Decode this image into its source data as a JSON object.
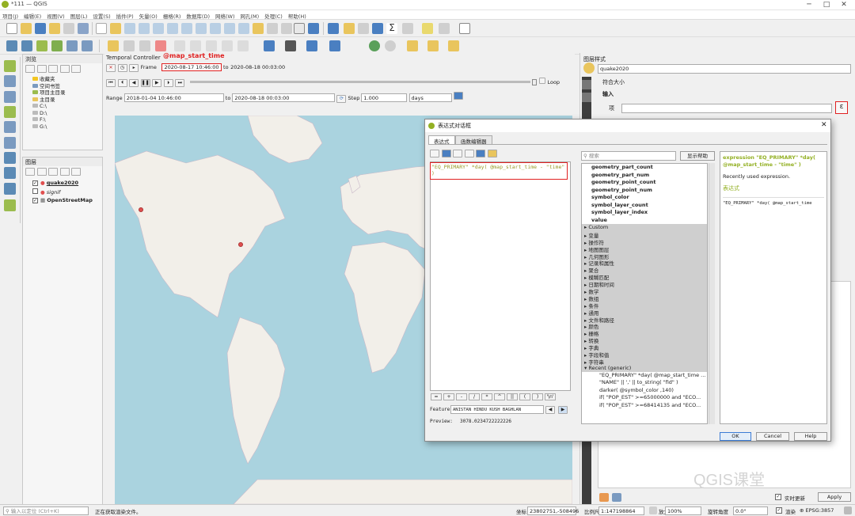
{
  "window": {
    "title": "*111 — QGIS"
  },
  "menu": [
    "项目(J)",
    "编辑(E)",
    "视图(V)",
    "图层(L)",
    "设置(S)",
    "插件(P)",
    "矢量(O)",
    "栅格(R)",
    "数据库(D)",
    "网络(W)",
    "网孔(M)",
    "处理(C)",
    "帮助(H)"
  ],
  "browser": {
    "title": "浏览",
    "items": [
      "收藏夹",
      "空间书签",
      "项目主目录",
      "主目录",
      "C:\\",
      "D:\\",
      "F:\\",
      "G:\\"
    ]
  },
  "layers": {
    "title": "图层",
    "items": [
      "quake2020",
      "signif",
      "OpenStreetMap"
    ]
  },
  "temporal": {
    "title": "Temporal Controller",
    "annotation": "@map_start_time",
    "frame_label": "Frame",
    "frame_start": "2020-08-17 10:46:00",
    "to_label": "to",
    "frame_end": "2020-08-18 00:03:00",
    "loop_label": "Loop",
    "range_label": "Range",
    "range_start": "2018-01-04 10:46:00",
    "range_end": "2020-08-18 00:03:00",
    "step_label": "Step",
    "step_value": "1.000",
    "step_unit": "days"
  },
  "styling": {
    "title": "图层样式",
    "layer": "quake2020",
    "size_label": "符合大小",
    "section": "输入",
    "item_label": "项",
    "epsilon": "ε",
    "live_update": "实时更新",
    "apply": "Apply"
  },
  "dialog": {
    "title": "表达式对话框",
    "tabs": [
      "表达式",
      "函数编辑器"
    ],
    "expression": "\"EQ_PRIMARY\" *day( @map_start_time - \"time\" )",
    "search_placeholder": "搜索",
    "show_help": "显示帮助",
    "ops": [
      "=",
      "+",
      "-",
      "/",
      "*",
      "^",
      "||",
      "(",
      ")",
      "'\\n'"
    ],
    "feature_label": "Feature",
    "feature_value": "ANISTAN  HINDU KUSH  BAGHLAN",
    "preview_label": "Preview:",
    "preview_value": "3078.0234722222226",
    "functions_bold": [
      "geometry_part_count",
      "geometry_part_num",
      "geometry_point_count",
      "geometry_point_num",
      "symbol_color",
      "symbol_layer_count",
      "symbol_layer_index",
      "value"
    ],
    "groups": [
      "Custom",
      "变量",
      "操作符",
      "地图图层",
      "几何图形",
      "记录和属性",
      "聚合",
      "模糊匹配",
      "日期和时间",
      "数学",
      "数组",
      "条件",
      "通用",
      "文件和路径",
      "颜色",
      "栅格",
      "转换",
      "字典",
      "字段和值",
      "字符串",
      "Recent (generic)"
    ],
    "recent": [
      "\"EQ_PRIMARY\" *day( @map_start_time ...",
      "\"NAME\"  ||  ','  ||  to_string(  \"fid\"  )",
      "darker( @symbol_color ,140)",
      "if( \"POP_EST\" >=65000000  and  \"ECO...",
      "if( \"POP_EST\" >=68414135 and  \"ECO..."
    ],
    "help_title": "expression \"EQ_PRIMARY\" *day( @map_start_time - \"time\" )",
    "help_desc": "Recently used expression.",
    "help_section": "表达式",
    "help_code": "\"EQ_PRIMARY\" *day( @map_start_time",
    "ok": "OK",
    "cancel": "Cancel",
    "help": "Help"
  },
  "status": {
    "locate_placeholder": "输入以定位 (Ctrl+K)",
    "message": "正在获取渲染文件。",
    "coord_label": "坐标",
    "coord_value": "23802751,-508496",
    "scale_label": "比例尺",
    "scale_value": "1:147198864",
    "magnifier_label": "放大镜",
    "magnifier_value": "100%",
    "rotation_label": "旋转角度",
    "rotation_value": "0.0°",
    "render_label": "渲染",
    "crs": "EPSG:3857"
  },
  "watermark": "QGIS课堂"
}
